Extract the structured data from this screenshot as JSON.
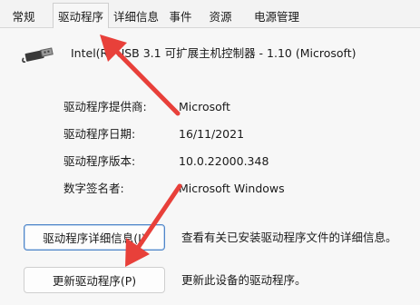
{
  "tabs": [
    {
      "label": "常规",
      "active": false
    },
    {
      "label": "驱动程序",
      "active": true
    },
    {
      "label": "详细信息",
      "active": false
    },
    {
      "label": "事件",
      "active": false
    },
    {
      "label": "资源",
      "active": false
    },
    {
      "label": "电源管理",
      "active": false
    }
  ],
  "device": {
    "icon": "usb-icon",
    "name": "Intel(R) USB 3.1 可扩展主机控制器 - 1.10 (Microsoft)"
  },
  "properties": [
    {
      "label": "驱动程序提供商:",
      "value": "Microsoft"
    },
    {
      "label": "驱动程序日期:",
      "value": "16/11/2021"
    },
    {
      "label": "驱动程序版本:",
      "value": "10.0.22000.348"
    },
    {
      "label": "数字签名者:",
      "value": "Microsoft Windows"
    }
  ],
  "actions": [
    {
      "button": "驱动程序详细信息(I)",
      "description": "查看有关已安装驱动程序文件的详细信息。"
    },
    {
      "button": "更新驱动程序(P)",
      "description": "更新此设备的驱动程序。"
    }
  ],
  "colors": {
    "annotation_arrow": "#e8403a",
    "focus_border": "#4f86c9"
  }
}
